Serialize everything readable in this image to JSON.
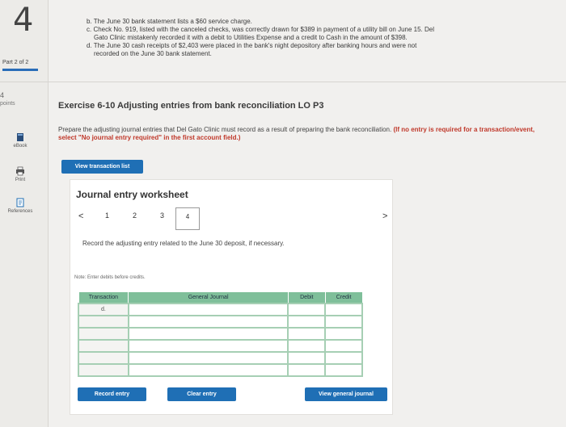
{
  "header": {
    "question_number": "4",
    "part_label": "Part 2 of 2",
    "points_value": "4",
    "points_label": "points"
  },
  "side_tools": [
    {
      "label": "eBook",
      "icon": "book-icon"
    },
    {
      "label": "Print",
      "icon": "print-icon"
    },
    {
      "label": "References",
      "icon": "references-icon"
    }
  ],
  "previous_items": [
    "b. The June 30 bank statement lists a $60 service charge.",
    "c. Check No. 919, listed with the canceled checks, was correctly drawn for $389 in payment of a utility bill on June 15. Del",
    "    Gato Clinic mistakenly recorded it with a debit to Utilities Expense and a credit to Cash in the amount of $398.",
    "d. The June 30 cash receipts of $2,403 were placed in the bank's night depository after banking hours and were not",
    "    recorded on the June 30 bank statement."
  ],
  "exercise": {
    "title": "Exercise 6-10 Adjusting entries from bank reconciliation LO P3",
    "instruction_plain": "Prepare the adjusting journal entries that Del Gato Clinic must record as a result of preparing the bank reconciliation.",
    "instruction_red": "(If no entry is required for a transaction/event, select \"No journal entry required\" in the first account field.)",
    "view_transaction_list": "View transaction list"
  },
  "worksheet": {
    "title": "Journal entry worksheet",
    "pages": [
      "1",
      "2",
      "3",
      "4"
    ],
    "active_page": "4",
    "prev_arrow": "<",
    "next_arrow": ">",
    "prompt": "Record the adjusting entry related to the June 30 deposit, if necessary.",
    "note": "Note: Enter debits before credits.",
    "columns": {
      "transaction": "Transaction",
      "general_journal": "General Journal",
      "debit": "Debit",
      "credit": "Credit"
    },
    "first_transaction": "d.",
    "buttons": {
      "record": "Record entry",
      "clear": "Clear entry",
      "view_journal": "View general journal"
    }
  }
}
